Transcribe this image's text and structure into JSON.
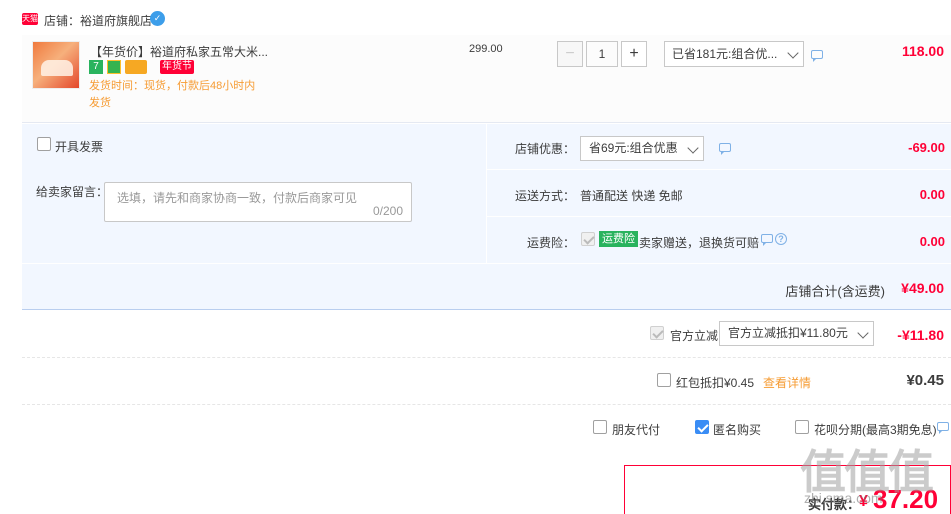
{
  "shop": {
    "badge": "天猫",
    "name": "店铺：裕道府旗舰店",
    "ww_icon": "✓"
  },
  "item": {
    "title": "【年货价】裕道府私家五常大米...",
    "badges": {
      "seven": "7",
      "festival": "年货节"
    },
    "ship_time": "发货时间：现货，付款后48小时内发货",
    "price": "299.00",
    "quantity": "1",
    "minus": "−",
    "plus": "+",
    "promo_selected": "已省181元:组合优...",
    "subtotal": "118.00"
  },
  "options": {
    "invoice_label": "开具发票",
    "message_label": "给卖家留言：",
    "message_placeholder": "选填，请先和商家协商一致，付款后商家可见",
    "message_count": "0/200",
    "shop_coupon_label": "店铺优惠：",
    "shop_coupon_selected": "省69元:组合优惠",
    "shop_coupon_amount": "-69.00",
    "shipping_label": "运送方式：",
    "shipping_value": "普通配送 快递 免邮",
    "shipping_amount": "0.00",
    "insurance_label": "运费险：",
    "insurance_badge": "运费险",
    "insurance_text": "卖家赠送，退换货可赔",
    "insurance_amount": "0.00",
    "shop_total_label": "店铺合计(含运费)",
    "shop_total_value": "¥49.00"
  },
  "summary": {
    "official_label": "官方立减",
    "official_selected": "官方立减抵扣¥11.80元",
    "official_amount": "-¥11.80",
    "redpacket_label": "红包抵扣¥0.45",
    "redpacket_link": "查看详情",
    "redpacket_amount": "¥0.45",
    "friend_pay": "朋友代付",
    "anonymous": "匿名购买",
    "huabei": "花呗分期(最高3期免息)"
  },
  "payable": {
    "label": "实付款：",
    "currency": "¥",
    "amount": "37.20"
  },
  "watermark": {
    "big": "值值值",
    "small": "zhi.sma.com"
  },
  "colors": {
    "accent_red": "#ff0036",
    "panel_blue": "#f2f7ff",
    "ship_orange": "#f69c34",
    "check_blue": "#3a8df5"
  }
}
